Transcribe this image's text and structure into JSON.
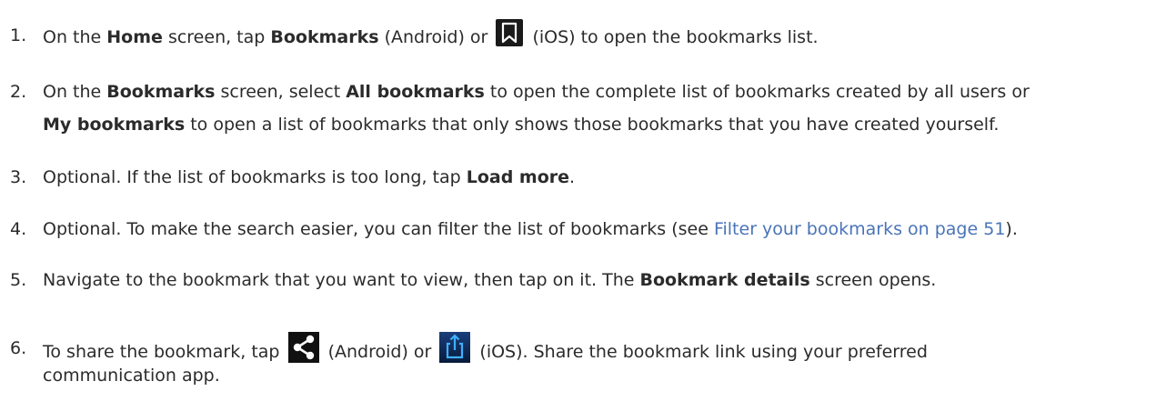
{
  "steps": [
    {
      "number": "1.",
      "t1": "On the ",
      "b1": "Home",
      "t2": " screen, tap ",
      "b2": "Bookmarks",
      "t3": " (Android) or ",
      "t4": " (iOS) to open the bookmarks list."
    },
    {
      "number": "2.",
      "t1": "On the ",
      "b1": "Bookmarks",
      "t2": " screen, select ",
      "b2": "All bookmarks",
      "t3": " to open the complete list of bookmarks created by all users or",
      "b3": "My bookmarks",
      "t4": " to open a list of bookmarks that only shows those bookmarks that you have created yourself."
    },
    {
      "number": "3.",
      "t1": "Optional. If the list of bookmarks is too long, tap ",
      "b1": "Load more",
      "t2": "."
    },
    {
      "number": "4.",
      "t1": "Optional. To make the search easier, you can filter the list of bookmarks (see ",
      "link": "Filter your bookmarks on page 51",
      "t2": ")."
    },
    {
      "number": "5.",
      "t1": "Navigate to the bookmark that you want to view, then tap on it. The ",
      "b1": "Bookmark details",
      "t2": " screen opens."
    },
    {
      "number": "6.",
      "t1": "To share the bookmark, tap ",
      "t2": " (Android) or ",
      "t3": " (iOS). Share the bookmark link using your preferred",
      "t4": "communication app."
    }
  ],
  "icons": {
    "bookmark_ios": "bookmark-icon",
    "share_android": "share-icon",
    "share_ios": "share-upload-icon"
  },
  "colors": {
    "text": "#2b2b2b",
    "link": "#4a74b8",
    "icon_dark": "#1a1a1a",
    "icon_blue_bg": "#0d2a5c"
  }
}
